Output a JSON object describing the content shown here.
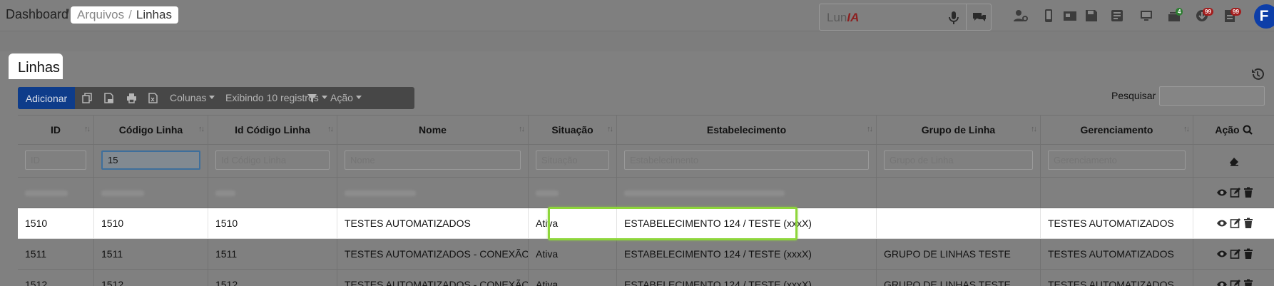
{
  "breadcrumb": {
    "dashboard": "Dashboard",
    "sep": "/",
    "arquivos": "Arquivos",
    "sep2": "/",
    "linhas": "Linhas"
  },
  "luna": {
    "prefix": "Lun",
    "suffix": "IA"
  },
  "topbar_icons": [
    {
      "name": "user-settings-icon"
    },
    {
      "name": "mobile-phone-icon"
    },
    {
      "name": "sim-card-icon"
    },
    {
      "name": "save-icon"
    },
    {
      "name": "invoice-icon"
    },
    {
      "name": "monitor-icon"
    },
    {
      "name": "tray-icon",
      "badge": "4",
      "badge_color": "#2e7d32"
    },
    {
      "name": "download-icon",
      "badge": "99",
      "badge_color": "#a31d1d"
    },
    {
      "name": "document-icon",
      "badge": "99",
      "badge_color": "#a31d1d"
    }
  ],
  "avatar": {
    "initial": "F"
  },
  "page": {
    "title": "Linhas"
  },
  "toolbar": {
    "add_label": "Adicionar",
    "columns_label": "Colunas",
    "showing_label": "Exibindo 10 registros",
    "action_label": "Ação",
    "icons": [
      "copy-icon",
      "csv-icon",
      "print-icon",
      "excel-icon",
      "filter-icon"
    ]
  },
  "search": {
    "label": "Pesquisar",
    "value": ""
  },
  "table": {
    "headers": [
      "ID",
      "Código Linha",
      "Id Código Linha",
      "Nome",
      "Situação",
      "Estabelecimento",
      "Grupo de Linha",
      "Gerenciamento",
      "Ação"
    ],
    "filters": {
      "id": {
        "placeholder": "ID",
        "value": ""
      },
      "codigo": {
        "placeholder": "Código Linha",
        "value": "15"
      },
      "id_codigo": {
        "placeholder": "Id Código Linha",
        "value": ""
      },
      "nome": {
        "placeholder": "Nome",
        "value": ""
      },
      "situacao": {
        "placeholder": "Situação",
        "value": ""
      },
      "estabelecimento": {
        "placeholder": "Estabelecimento",
        "value": ""
      },
      "grupo": {
        "placeholder": "Grupo de Linha",
        "value": ""
      },
      "gerenciamento": {
        "placeholder": "Gerenciamento",
        "value": ""
      }
    },
    "rows": [
      {
        "id": "1510",
        "codigo": "1510",
        "id_codigo": "1510",
        "nome": "TESTES AUTOMATIZADOS",
        "situacao": "Ativa",
        "estabelecimento": "ESTABELECIMENTO 124 / TESTE (xxxX)",
        "grupo": "",
        "gerenciamento": "TESTES AUTOMATIZADOS"
      },
      {
        "id": "1511",
        "codigo": "1511",
        "id_codigo": "1511",
        "nome": "TESTES AUTOMATIZADOS - CONEXÃO I",
        "situacao": "Ativa",
        "estabelecimento": "ESTABELECIMENTO 124 / TESTE (xxxX)",
        "grupo": "GRUPO DE LINHAS TESTE",
        "gerenciamento": "TESTES AUTOMATIZADOS"
      },
      {
        "id": "1512",
        "codigo": "1512",
        "id_codigo": "1512",
        "nome": "TESTES AUTOMATIZADOS - CONEXÃO II",
        "situacao": "Ativa",
        "estabelecimento": "ESTABELECIMENTO 124 / TESTE (xxxX)",
        "grupo": "GRUPO DE LINHAS TESTE",
        "gerenciamento": "TESTES AUTOMATIZADOS"
      }
    ]
  },
  "colors": {
    "accent_blue": "#0e3c8a",
    "highlight_green": "#8ed63b",
    "avatar_blue": "#0d3ea8"
  }
}
